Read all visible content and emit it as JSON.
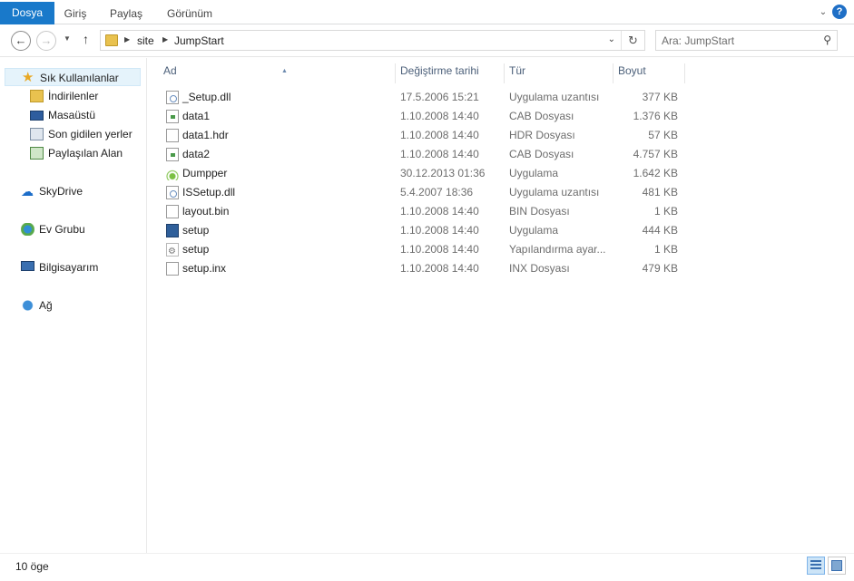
{
  "ribbon": {
    "tabs": [
      "Dosya",
      "Giriş",
      "Paylaş",
      "Görünüm"
    ],
    "help_label": "?"
  },
  "address": {
    "path": [
      "site",
      "JumpStart"
    ]
  },
  "search": {
    "placeholder": "Ara: JumpStart"
  },
  "nav": {
    "items": [
      {
        "label": "Sık Kullanılanlar",
        "icon": "star-icon"
      },
      {
        "label": "İndirilenler",
        "icon": "downloads-icon"
      },
      {
        "label": "Masaüstü",
        "icon": "desktop-icon"
      },
      {
        "label": "Son gidilen yerler",
        "icon": "recent-places-icon"
      },
      {
        "label": "Paylaşılan Alan",
        "icon": "shared-folder-icon"
      },
      {
        "label": "SkyDrive",
        "icon": "cloud-icon"
      },
      {
        "label": "Ev Grubu",
        "icon": "homegroup-icon"
      },
      {
        "label": "Bilgisayarım",
        "icon": "computer-icon"
      },
      {
        "label": "Ağ",
        "icon": "network-icon"
      }
    ]
  },
  "columns": {
    "name": "Ad",
    "date": "Değiştirme tarihi",
    "type": "Tür",
    "size": "Boyut"
  },
  "files": [
    {
      "name": "_Setup.dll",
      "date": "17.5.2006 15:21",
      "type": "Uygulama uzantısı",
      "size": "377 KB",
      "icon": "dll-file-icon"
    },
    {
      "name": "data1",
      "date": "1.10.2008 14:40",
      "type": "CAB Dosyası",
      "size": "1.376 KB",
      "icon": "cab-file-icon"
    },
    {
      "name": "data1.hdr",
      "date": "1.10.2008 14:40",
      "type": "HDR Dosyası",
      "size": "57 KB",
      "icon": "file-icon"
    },
    {
      "name": "data2",
      "date": "1.10.2008 14:40",
      "type": "CAB Dosyası",
      "size": "4.757 KB",
      "icon": "cab-file-icon"
    },
    {
      "name": "Dumpper",
      "date": "30.12.2013 01:36",
      "type": "Uygulama",
      "size": "1.642 KB",
      "icon": "wifi-app-icon"
    },
    {
      "name": "ISSetup.dll",
      "date": "5.4.2007 18:36",
      "type": "Uygulama uzantısı",
      "size": "481 KB",
      "icon": "dll-file-icon"
    },
    {
      "name": "layout.bin",
      "date": "1.10.2008 14:40",
      "type": "BIN Dosyası",
      "size": "1 KB",
      "icon": "file-icon"
    },
    {
      "name": "setup",
      "date": "1.10.2008 14:40",
      "type": "Uygulama",
      "size": "444 KB",
      "icon": "setup-app-icon"
    },
    {
      "name": "setup",
      "date": "1.10.2008 14:40",
      "type": "Yapılandırma ayar...",
      "size": "1 KB",
      "icon": "config-file-icon"
    },
    {
      "name": "setup.inx",
      "date": "1.10.2008 14:40",
      "type": "INX Dosyası",
      "size": "479 KB",
      "icon": "file-icon"
    }
  ],
  "status": {
    "item_count": "10 öge"
  },
  "colors": {
    "file_tab": "#1979ca",
    "header_text": "#4c607a",
    "selection": "#e5f3fb"
  }
}
